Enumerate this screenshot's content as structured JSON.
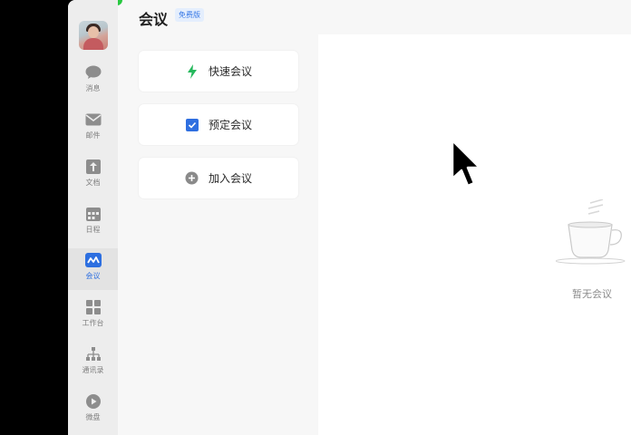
{
  "header": {
    "title": "会议",
    "badge": "免费版"
  },
  "sidebar": {
    "items": [
      {
        "label": "消息",
        "icon": "chat-bubble-icon"
      },
      {
        "label": "邮件",
        "icon": "mail-icon"
      },
      {
        "label": "文档",
        "icon": "document-icon"
      },
      {
        "label": "日程",
        "icon": "calendar-icon"
      },
      {
        "label": "会议",
        "icon": "meeting-icon",
        "active": true
      },
      {
        "label": "工作台",
        "icon": "grid-icon"
      },
      {
        "label": "通讯录",
        "icon": "contacts-icon"
      },
      {
        "label": "微盘",
        "icon": "drive-icon"
      }
    ]
  },
  "actions": [
    {
      "label": "快速会议",
      "icon": "lightning-icon",
      "color": "#25b85c"
    },
    {
      "label": "预定会议",
      "icon": "checkbox-icon",
      "color": "#2f6fe0"
    },
    {
      "label": "加入会议",
      "icon": "plus-circle-icon",
      "color": "#8a8a8a"
    }
  ],
  "main": {
    "empty_text": "暂无会议"
  },
  "colors": {
    "accent": "#2d6fe0",
    "green": "#25b85c"
  }
}
